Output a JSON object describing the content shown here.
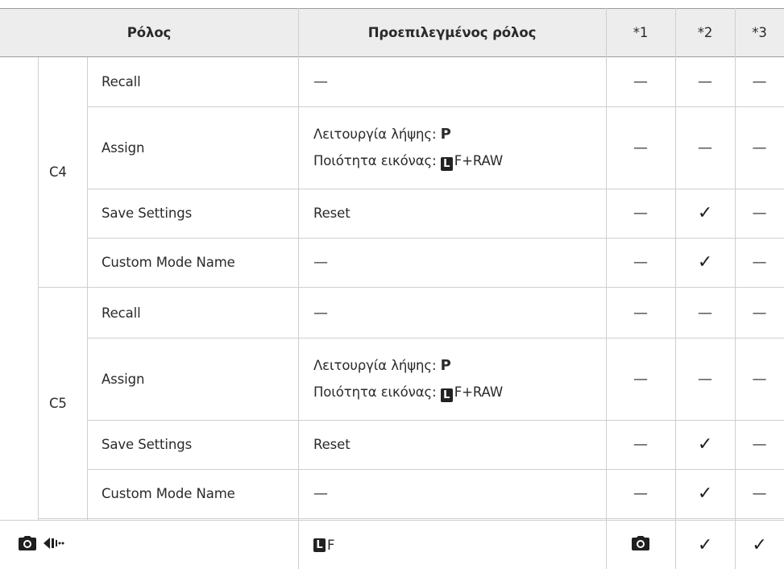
{
  "header": {
    "role": "Ρόλος",
    "default_role": "Προεπιλεγμένος ρόλος",
    "col1": "*1",
    "col2": "*2",
    "col3": "*3"
  },
  "groups": [
    {
      "name": "C4",
      "rows": [
        {
          "function": "Recall",
          "default": "—",
          "c1": "—",
          "c2": "—",
          "c3": "—"
        },
        {
          "function": "Assign",
          "default_line1_prefix": "Λειτουργία λήψης:",
          "default_line1_value": "P",
          "default_line2_prefix": "Ποιότητα εικόνας:",
          "default_line2_badge": "L",
          "default_line2_value": "F+RAW",
          "c1": "—",
          "c2": "—",
          "c3": "—"
        },
        {
          "function": "Save Settings",
          "default": "Reset",
          "c1": "—",
          "c2": "✓",
          "c3": "—"
        },
        {
          "function": "Custom Mode Name",
          "default": "—",
          "c1": "—",
          "c2": "✓",
          "c3": "—"
        }
      ]
    },
    {
      "name": "C5",
      "rows": [
        {
          "function": "Recall",
          "default": "—",
          "c1": "—",
          "c2": "—",
          "c3": "—"
        },
        {
          "function": "Assign",
          "default_line1_prefix": "Λειτουργία λήψης:",
          "default_line1_value": "P",
          "default_line2_prefix": "Ποιότητα εικόνας:",
          "default_line2_badge": "L",
          "default_line2_value": "F+RAW",
          "c1": "—",
          "c2": "—",
          "c3": "—"
        },
        {
          "function": "Save Settings",
          "default": "Reset",
          "c1": "—",
          "c2": "✓",
          "c3": "—"
        },
        {
          "function": "Custom Mode Name",
          "default": "—",
          "c1": "—",
          "c2": "✓",
          "c3": "—"
        }
      ]
    }
  ],
  "last_row": {
    "icons": [
      "camera-icon",
      "drive-sequential-icon"
    ],
    "default_badge": "L",
    "default_value": "F",
    "c1_icon": "camera-icon",
    "c2": "✓",
    "c3": "✓"
  }
}
